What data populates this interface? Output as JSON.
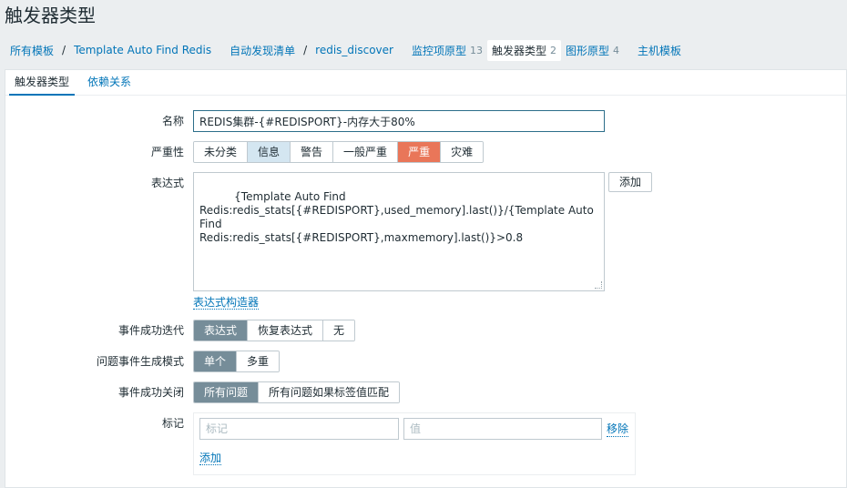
{
  "page": {
    "title": "触发器类型"
  },
  "breadcrumbs": [
    {
      "label": "所有模板"
    },
    {
      "label": "Template Auto Find Redis"
    },
    {
      "label": "自动发现清单"
    },
    {
      "label": "redis_discover"
    },
    {
      "label": "监控项原型",
      "count": "13"
    },
    {
      "label": "触发器类型",
      "count": "2"
    },
    {
      "label": "图形原型",
      "count": "4"
    },
    {
      "label": "主机模板"
    }
  ],
  "tabs": [
    {
      "label": "触发器类型",
      "active": true
    },
    {
      "label": "依赖关系",
      "active": false
    }
  ],
  "form": {
    "name": {
      "label": "名称",
      "value": "REDIS集群-{#REDISPORT}-内存大于80%"
    },
    "severity": {
      "label": "严重性",
      "options": [
        "未分类",
        "信息",
        "警告",
        "一般严重",
        "严重",
        "灾难"
      ],
      "selected": "严重"
    },
    "expression": {
      "label": "表达式",
      "value": "{Template Auto Find\nRedis:redis_stats[{#REDISPORT},used_memory].last()}/{Template Auto Find\nRedis:redis_stats[{#REDISPORT},maxmemory].last()}>0.8",
      "add_button": "添加",
      "builder_link": "表达式构造器"
    },
    "ok_event_generation": {
      "label": "事件成功迭代",
      "options": [
        "表达式",
        "恢复表达式",
        "无"
      ],
      "selected": "表达式"
    },
    "problem_mode": {
      "label": "问题事件生成模式",
      "options": [
        "单个",
        "多重"
      ],
      "selected": "单个"
    },
    "ok_close": {
      "label": "事件成功关闭",
      "options": [
        "所有问题",
        "所有问题如果标签值匹配"
      ],
      "selected": "所有问题"
    },
    "tags": {
      "label": "标记",
      "tag_placeholder": "标记",
      "value_placeholder": "值",
      "remove_link": "移除",
      "add_link": "添加"
    }
  },
  "colors": {
    "link": "#0275b8",
    "severity_high": "#e97659",
    "severity_info": "#d4e6f1",
    "selected_segment": "#768d99"
  }
}
